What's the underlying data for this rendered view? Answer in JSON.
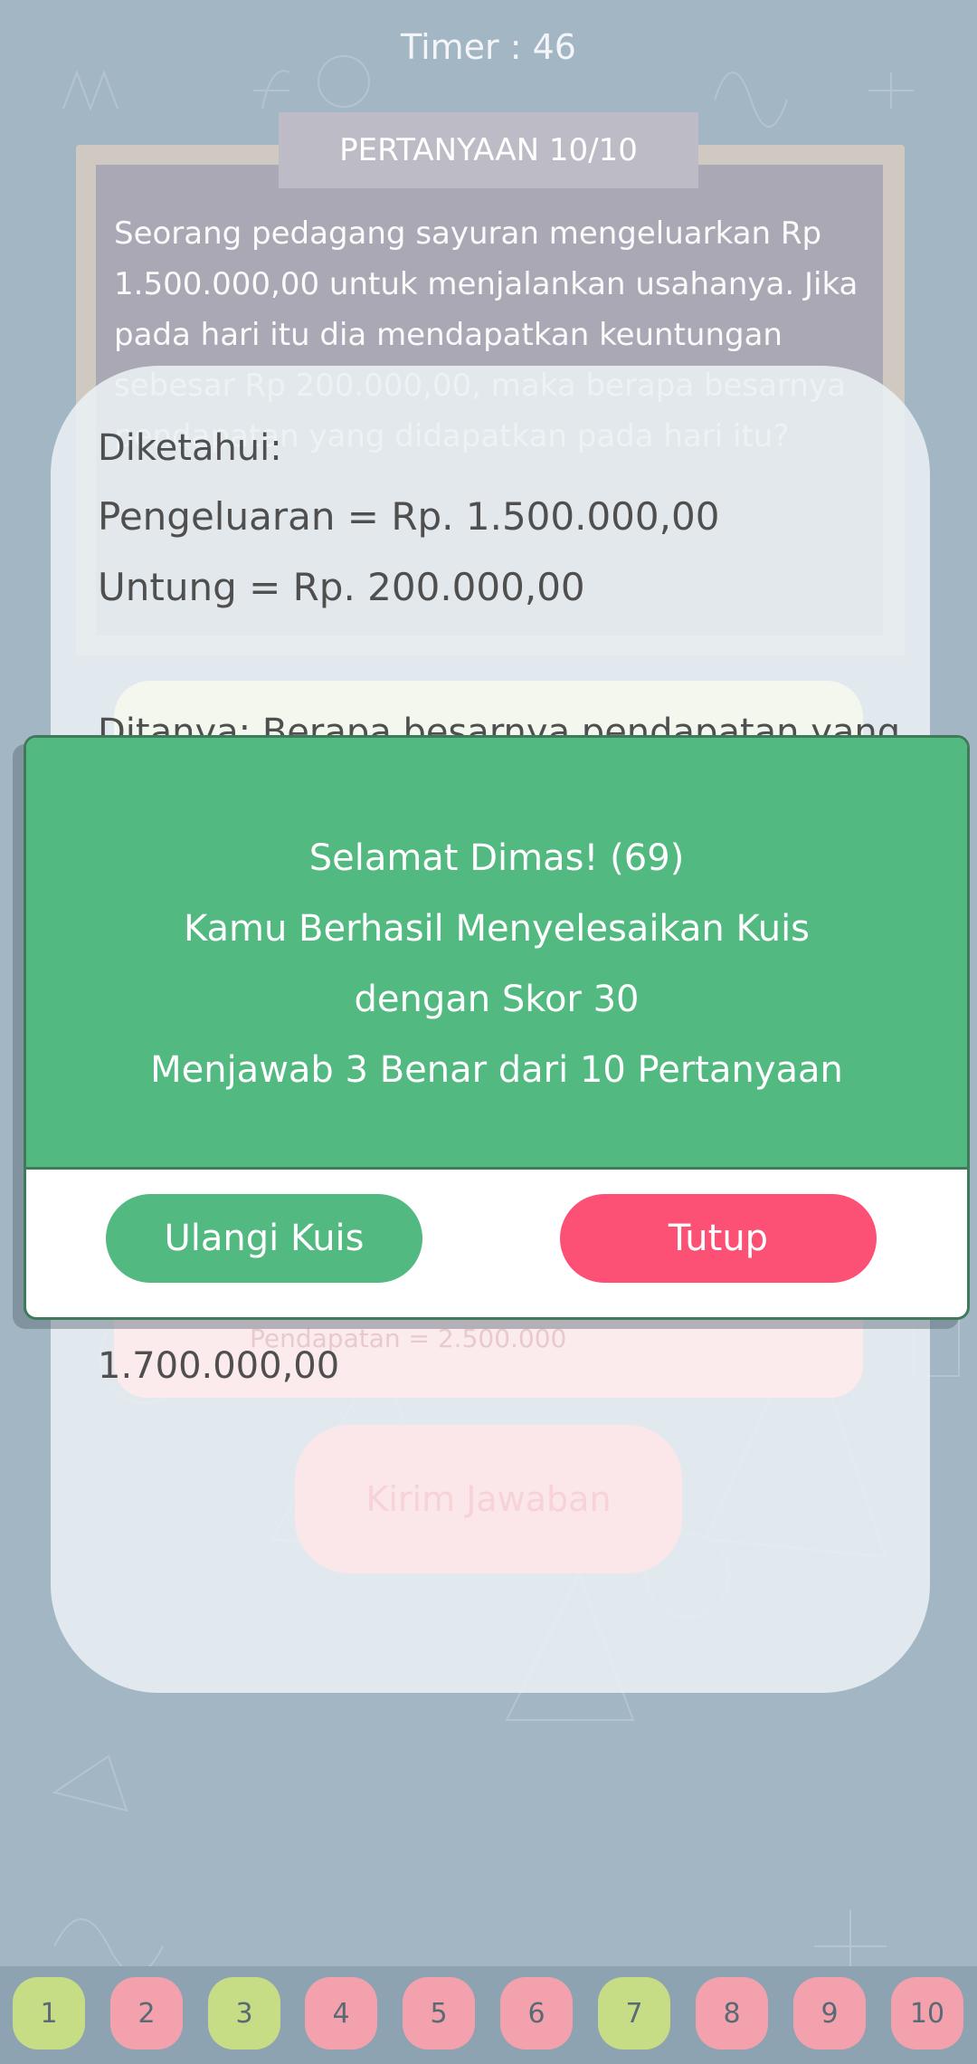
{
  "timer": "Timer : 46",
  "question": {
    "title": "PERTANYAAN 10/10",
    "text": "Seorang pedagang sayuran mengeluarkan Rp 1.500.000,00 untuk menjalankan usahanya. Jika pada hari itu dia mendapatkan keuntungan sebesar Rp 200.000,00, maka berapa besarnya pendapatan yang didapatkan pada hari itu?"
  },
  "answer": {
    "known_title": "Diketahui:",
    "known_lines": [
      "Pengeluaran = Rp. 1.500.000,00",
      "Untung = Rp. 200.000,00"
    ],
    "asked": "Ditanya: Berapa besarnya pendapatan yang",
    "selected_option_faint": "Pendapatan = 2.500.000",
    "value": "1.700.000,00",
    "submit_label": "Kirim Jawaban"
  },
  "dialog": {
    "lines": [
      "Selamat Dimas! (69)",
      "Kamu Berhasil Menyelesaikan Kuis",
      "dengan Skor 30",
      "Menjawab 3 Benar dari  10 Pertanyaan"
    ],
    "retry_label": "Ulangi Kuis",
    "close_label": "Tutup"
  },
  "nav": [
    {
      "label": "1",
      "status": "correct"
    },
    {
      "label": "2",
      "status": "wrong"
    },
    {
      "label": "3",
      "status": "correct"
    },
    {
      "label": "4",
      "status": "wrong"
    },
    {
      "label": "5",
      "status": "wrong"
    },
    {
      "label": "6",
      "status": "wrong"
    },
    {
      "label": "7",
      "status": "correct"
    },
    {
      "label": "8",
      "status": "wrong"
    },
    {
      "label": "9",
      "status": "wrong"
    },
    {
      "label": "10",
      "status": "wrong"
    }
  ],
  "colors": {
    "background": "#a3b6c4",
    "dialog_green": "#52b981",
    "close_pink": "#fc5175",
    "nav_correct": "#c7dd85",
    "nav_wrong": "#f3a2ad"
  }
}
